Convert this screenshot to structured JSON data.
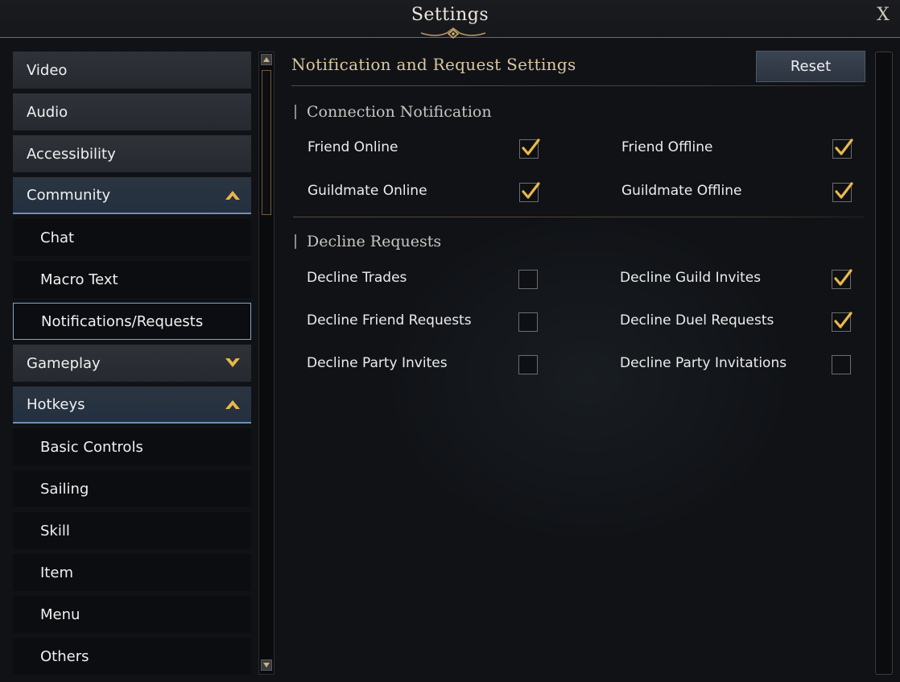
{
  "window": {
    "title": "Settings",
    "close_label": "X"
  },
  "sidebar": {
    "items": [
      {
        "label": "Video",
        "kind": "category"
      },
      {
        "label": "Audio",
        "kind": "category"
      },
      {
        "label": "Accessibility",
        "kind": "category"
      },
      {
        "label": "Community",
        "kind": "category",
        "expanded": true
      },
      {
        "label": "Chat",
        "kind": "sub"
      },
      {
        "label": "Macro Text",
        "kind": "sub"
      },
      {
        "label": "Notifications/Requests",
        "kind": "sub",
        "selected": true
      },
      {
        "label": "Gameplay",
        "kind": "category",
        "expanded": false
      },
      {
        "label": "Hotkeys",
        "kind": "category",
        "expanded": true
      },
      {
        "label": "Basic Controls",
        "kind": "sub"
      },
      {
        "label": "Sailing",
        "kind": "sub"
      },
      {
        "label": "Skill",
        "kind": "sub"
      },
      {
        "label": "Item",
        "kind": "sub"
      },
      {
        "label": "Menu",
        "kind": "sub"
      },
      {
        "label": "Others",
        "kind": "sub"
      }
    ]
  },
  "panel": {
    "title": "Notification and Request Settings",
    "reset_label": "Reset",
    "sections": [
      {
        "title": "Connection Notification",
        "options": [
          {
            "label": "Friend Online",
            "checked": true
          },
          {
            "label": "Friend Offline",
            "checked": true
          },
          {
            "label": "Guildmate Online",
            "checked": true
          },
          {
            "label": "Guildmate Offline",
            "checked": true
          }
        ]
      },
      {
        "title": "Decline Requests",
        "options": [
          {
            "label": "Decline Trades",
            "checked": false
          },
          {
            "label": "Decline Guild Invites",
            "checked": true
          },
          {
            "label": "Decline Friend Requests",
            "checked": false
          },
          {
            "label": "Decline Duel Requests",
            "checked": true
          },
          {
            "label": "Decline Party Invites",
            "checked": false
          },
          {
            "label": "Decline Party Invitations",
            "checked": false
          }
        ]
      }
    ]
  },
  "colors": {
    "accent_gold": "#d9c79f",
    "check_gold": "#e9b94a",
    "selection_blue": "#7fa6c8"
  },
  "icons": {
    "close": "close-icon",
    "expand": "chevron-up-icon",
    "collapse": "chevron-down-icon",
    "check": "checkmark-icon"
  }
}
